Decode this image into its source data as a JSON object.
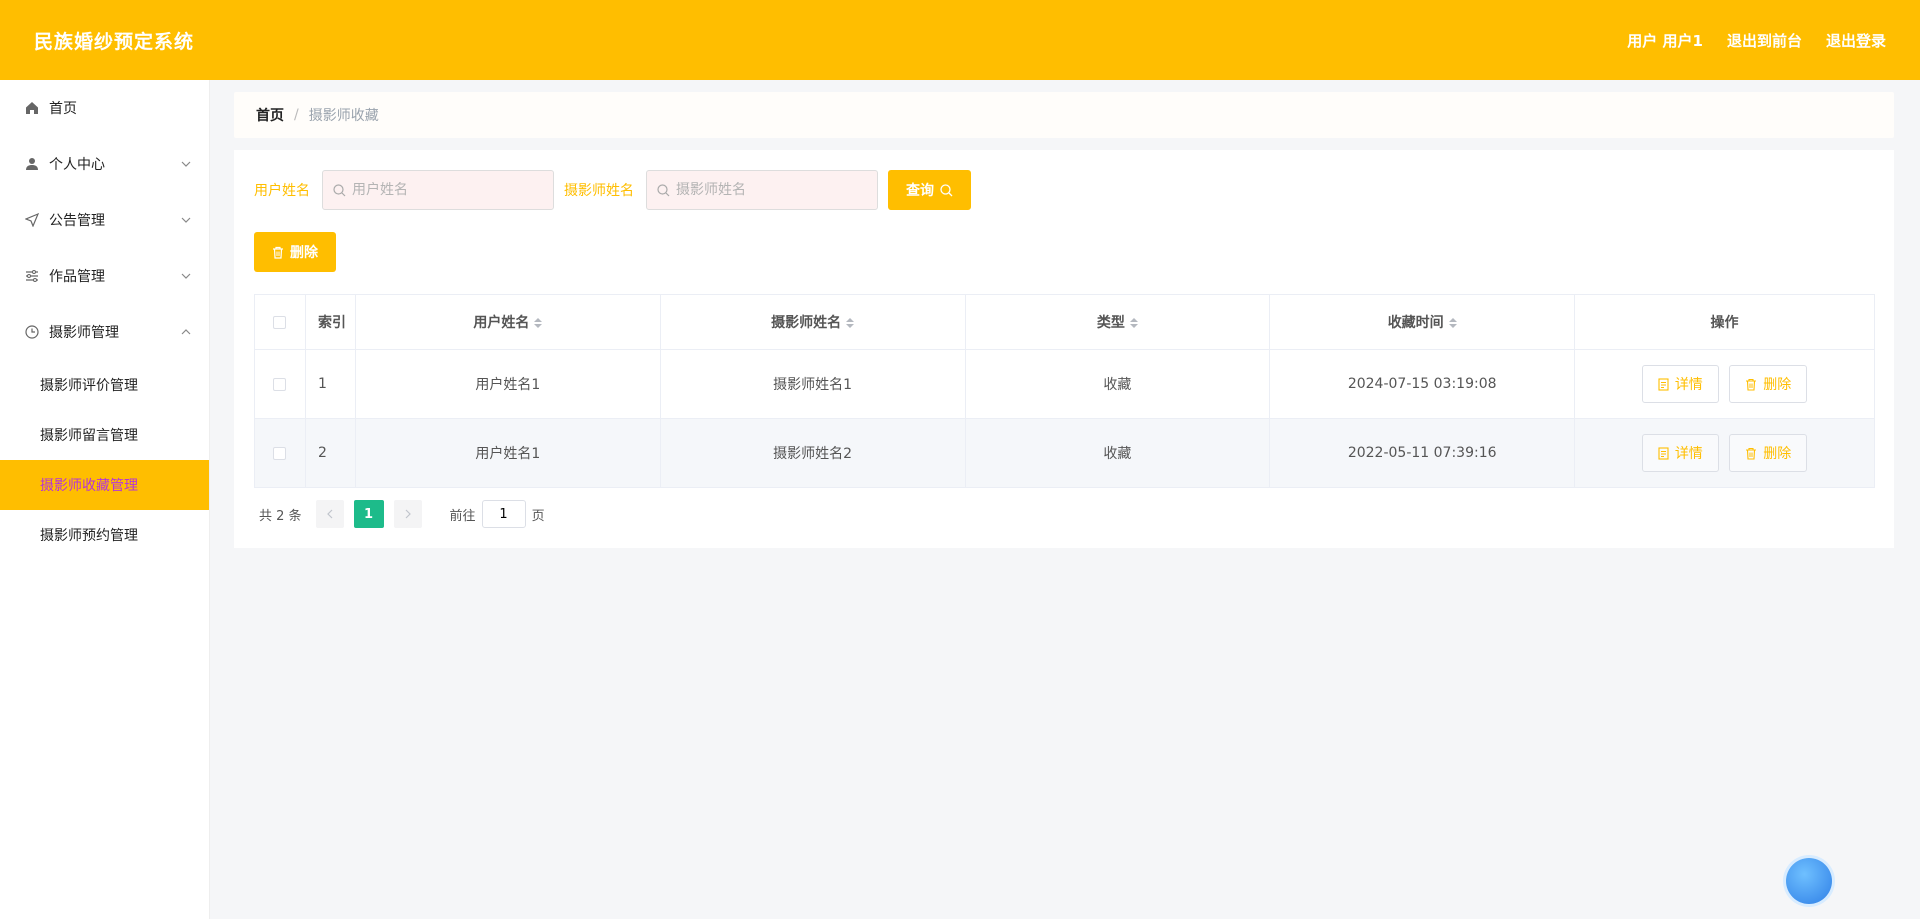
{
  "header": {
    "title": "民族婚纱预定系统",
    "user_label": "用户 用户1",
    "to_front": "退出到前台",
    "logout": "退出登录"
  },
  "sidebar": {
    "items": [
      {
        "label": "首页",
        "icon": "home-icon"
      },
      {
        "label": "个人中心",
        "icon": "user-icon"
      },
      {
        "label": "公告管理",
        "icon": "send-icon"
      },
      {
        "label": "作品管理",
        "icon": "sliders-icon"
      },
      {
        "label": "摄影师管理",
        "icon": "clock-icon"
      }
    ],
    "sub_items": [
      {
        "label": "摄影师评价管理"
      },
      {
        "label": "摄影师留言管理"
      },
      {
        "label": "摄影师收藏管理",
        "active": true
      },
      {
        "label": "摄影师预约管理"
      }
    ]
  },
  "breadcrumb": {
    "home": "首页",
    "current": "摄影师收藏"
  },
  "search": {
    "user_label": "用户姓名",
    "user_placeholder": "用户姓名",
    "photographer_label": "摄影师姓名",
    "photographer_placeholder": "摄影师姓名",
    "query_button": "查询",
    "delete_button": "删除"
  },
  "table": {
    "headers": {
      "index": "索引",
      "user_name": "用户姓名",
      "photographer_name": "摄影师姓名",
      "type": "类型",
      "time": "收藏时间",
      "ops": "操作"
    },
    "rows": [
      {
        "index": "1",
        "user_name": "用户姓名1",
        "photographer_name": "摄影师姓名1",
        "type": "收藏",
        "time": "2024-07-15 03:19:08"
      },
      {
        "index": "2",
        "user_name": "用户姓名1",
        "photographer_name": "摄影师姓名2",
        "type": "收藏",
        "time": "2022-05-11 07:39:16"
      }
    ],
    "detail_button": "详情",
    "delete_button": "删除"
  },
  "pagination": {
    "total": "共 2 条",
    "current_page": "1",
    "goto_label": "前往",
    "goto_value": "1",
    "page_suffix": "页"
  },
  "colors": {
    "accent": "#ffbe00",
    "active_text": "#b535d8",
    "page_active": "#1dbb8a"
  }
}
